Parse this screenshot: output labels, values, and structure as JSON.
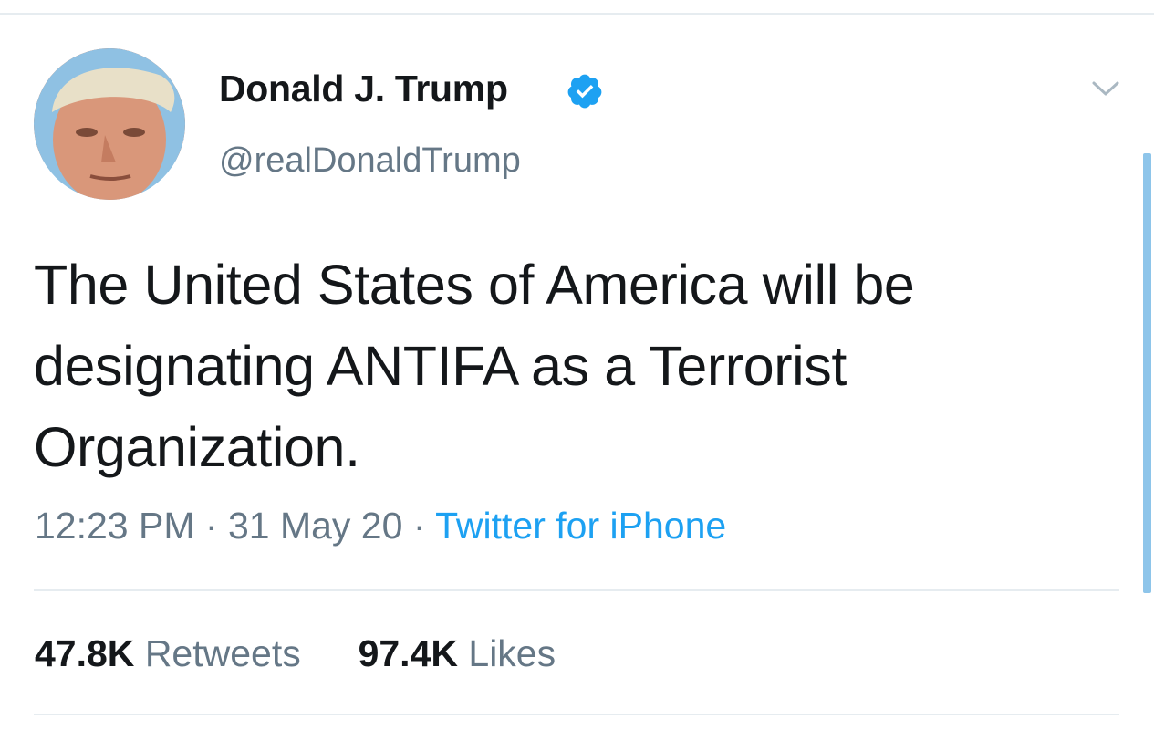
{
  "tweet": {
    "author": {
      "display_name": "Donald J. Trump",
      "handle": "@realDonaldTrump",
      "verified": true,
      "avatar_icon": "profile-photo"
    },
    "text_lines": [
      "The United States of America will be",
      "designating ANTIFA as a Terrorist",
      "Organization."
    ],
    "time": "12:23 PM",
    "separator": "·",
    "date": "31 May 20",
    "source": "Twitter for iPhone",
    "stats": {
      "retweets_count": "47.8K",
      "retweets_label": "Retweets",
      "likes_count": "97.4K",
      "likes_label": "Likes"
    }
  },
  "icons": {
    "verified": "verified-badge-icon",
    "menu": "chevron-down-icon"
  },
  "colors": {
    "accent": "#1da1f2",
    "text_primary": "#14171a",
    "text_secondary": "#657786",
    "divider": "#e6ecf0",
    "scrollbar": "#8ec5ea"
  }
}
